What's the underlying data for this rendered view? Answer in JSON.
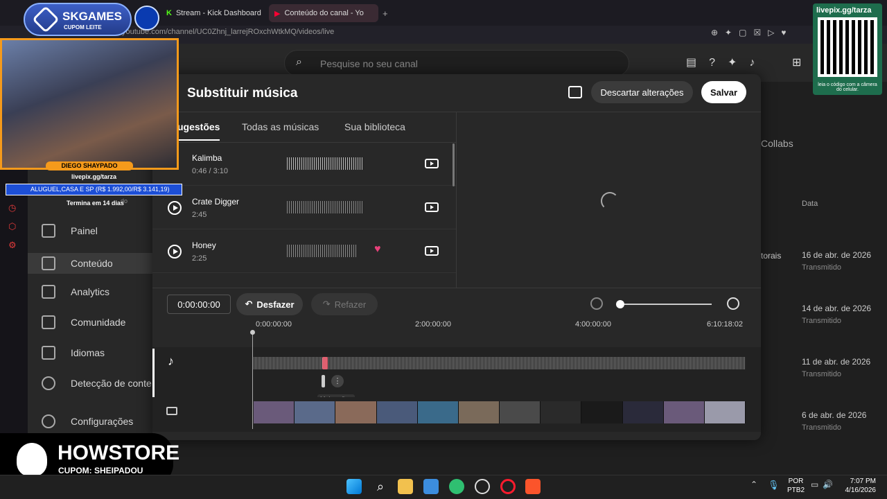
{
  "browser": {
    "tabs": [
      {
        "title": "Stream - Kick Dashboard"
      },
      {
        "title": "Conteúdo do canal - Yo"
      }
    ],
    "url": "youtube.com/channel/UC0Zhnj_larrejROxchWtkMQ/videos/live"
  },
  "studio": {
    "search_placeholder": "Pesquise no seu canal",
    "sidebar": [
      {
        "label": "Painel",
        "icon": "dashboard-icon"
      },
      {
        "label": "Conteúdo",
        "icon": "content-icon"
      },
      {
        "label": "Analytics",
        "icon": "analytics-icon"
      },
      {
        "label": "Comunidade",
        "icon": "community-icon"
      },
      {
        "label": "Idiomas",
        "icon": "subtitles-icon"
      },
      {
        "label": "Detecção de conte",
        "icon": "copyright-icon"
      },
      {
        "label": "Configurações",
        "icon": "gear-icon"
      }
    ],
    "collabs_tab": "Collabs",
    "date_header": "Data",
    "row_partial_text": "torais",
    "rows": [
      {
        "date": "16 de abr. de 2026",
        "status": "Transmitido"
      },
      {
        "date": "14 de abr. de 2026",
        "status": "Transmitido"
      },
      {
        "date": "11 de abr. de 2026",
        "status": "Transmitido"
      },
      {
        "date": "6 de abr. de 2026",
        "status": "Transmitido"
      }
    ]
  },
  "modal": {
    "title": "Substituir música",
    "discard_label": "Descartar alterações",
    "save_label": "Salvar",
    "tabs": [
      "ugestões",
      "Todas as músicas",
      "Sua biblioteca"
    ],
    "songs": [
      {
        "name": "Kalimba",
        "duration": "0:46 / 3:10",
        "liked": false
      },
      {
        "name": "Crate Digger",
        "duration": "2:45",
        "liked": false
      },
      {
        "name": "Honey",
        "duration": "2:25",
        "liked": true
      }
    ],
    "timecode": "0:00:00:00",
    "undo_label": "Desfazer",
    "redo_label": "Refazer",
    "ticks": [
      "0:00:00:00",
      "2:00:00:00",
      "4:00:00:00",
      "6:10:18:02"
    ],
    "more_actions_tooltip": "Mais ações",
    "zoom_level": 0
  },
  "overlays": {
    "skgames_title": "SKGAMES",
    "skgames_sub": "CUPOM LEITE",
    "streamer_name": "DIEGO SHAYPADO",
    "livepix_left": "livepix.gg/tarza",
    "goal_text": "ALUGUEL,CASA E SP (R$ 1.992,00/R$ 3.141,19)",
    "goal_partial": "do",
    "goal_ends": "Termina em 14 dias",
    "qr_title": "livepix.gg/tarza",
    "qr_caption": "leia o código com a câmera do celular.",
    "howstore_brand": "HOWSTORE",
    "howstore_coupon": "CUPOM: SHEIPADOU"
  },
  "taskbar": {
    "lang": "POR",
    "layout": "PTB2",
    "time": "7:07 PM",
    "date": "4/16/2026"
  },
  "colors": {
    "accent_red": "#ff0033",
    "like_pink": "#e8407a",
    "overlay_orange": "#f59a1b"
  }
}
